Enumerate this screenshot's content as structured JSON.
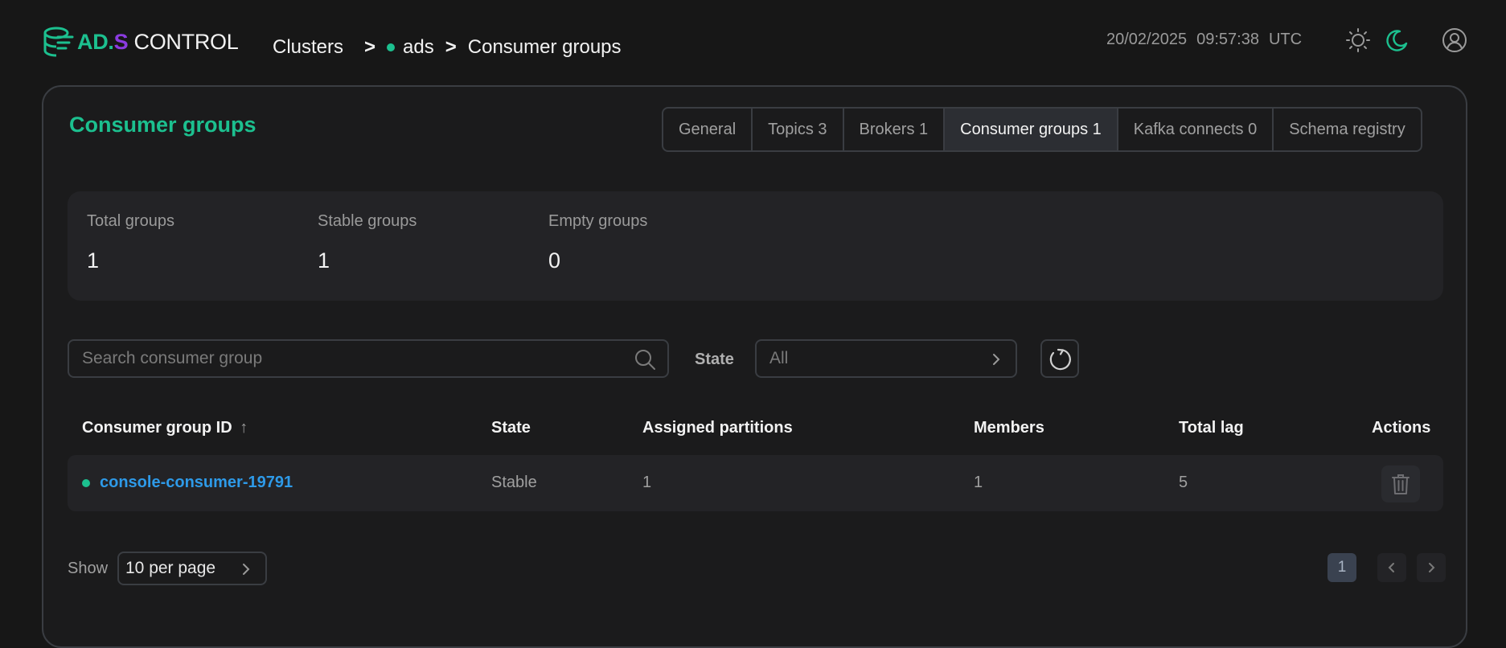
{
  "app": {
    "logo_ad": "AD.",
    "logo_s": "S",
    "logo_control": " CONTROL"
  },
  "breadcrumb": {
    "clusters": "Clusters",
    "sep1": ">",
    "cluster": "ads",
    "sep2": ">",
    "current": "Consumer groups"
  },
  "header": {
    "date": "20/02/2025",
    "time": "09:57:38",
    "tz": "UTC",
    "icons": [
      "sun-icon",
      "moon-icon",
      "user-icon"
    ]
  },
  "page": {
    "title": "Consumer groups"
  },
  "tabs": [
    {
      "label": "General"
    },
    {
      "label": "Topics 3"
    },
    {
      "label": "Brokers 1"
    },
    {
      "label": "Consumer groups 1",
      "active": true
    },
    {
      "label": "Kafka connects 0"
    },
    {
      "label": "Schema registry"
    }
  ],
  "stats": [
    {
      "label": "Total groups",
      "value": "1"
    },
    {
      "label": "Stable groups",
      "value": "1"
    },
    {
      "label": "Empty groups",
      "value": "0"
    }
  ],
  "filters": {
    "search_placeholder": "Search consumer group",
    "state_label": "State",
    "state_value": "All"
  },
  "table": {
    "headers": [
      "Consumer group ID",
      "State",
      "Assigned partitions",
      "Members",
      "Total lag",
      "Actions"
    ],
    "sort_indicator": "↑",
    "rows": [
      {
        "id": "console-consumer-19791",
        "state": "Stable",
        "partitions": "1",
        "members": "1",
        "lag": "5"
      }
    ]
  },
  "pagination": {
    "show_label": "Show",
    "per_page": "10 per page",
    "current_page": "1"
  },
  "colors": {
    "accent": "#1cc08f",
    "brand_purple": "#8b3be0",
    "link": "#2e9ae8",
    "background": "#171717"
  }
}
